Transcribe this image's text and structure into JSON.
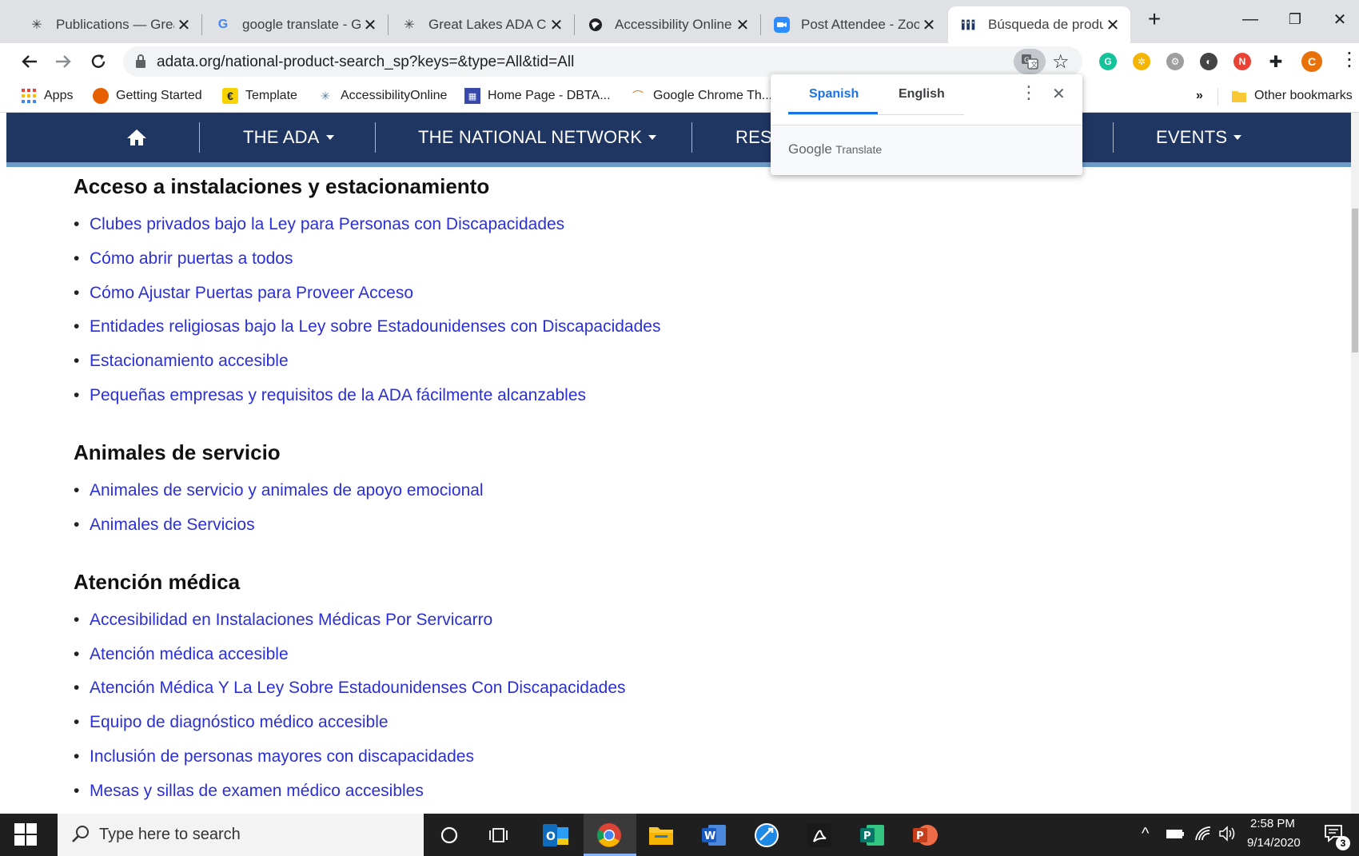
{
  "tabs": [
    {
      "title": "Publications — Great",
      "icon": "great-lakes-icon"
    },
    {
      "title": "google translate - Go",
      "icon": "google-icon"
    },
    {
      "title": "Great Lakes ADA Cen",
      "icon": "great-lakes-icon"
    },
    {
      "title": "Accessibility Online S",
      "icon": "globe-icon"
    },
    {
      "title": "Post Attendee - Zoo",
      "icon": "zoom-icon"
    },
    {
      "title": "Búsqueda de produc",
      "icon": "adata-icon"
    }
  ],
  "toolbar": {
    "url": "adata.org/national-product-search_sp?keys=&type=All&tid=All",
    "profile_initial": "C"
  },
  "bookmarks": {
    "items": [
      "Apps",
      "Getting Started",
      "Template",
      "AccessibilityOnline",
      "Home Page - DBTA...",
      "Google Chrome Th..."
    ],
    "overflow": "»",
    "other": "Other bookmarks"
  },
  "sitenav": {
    "items": [
      "THE ADA",
      "THE NATIONAL NETWORK",
      "RES",
      "EVENTS"
    ]
  },
  "translate": {
    "lang_source": "Spanish",
    "lang_target": "English",
    "brand": "Google",
    "brand_suffix": "Translate"
  },
  "content": {
    "sections": [
      {
        "heading": "Acceso a instalaciones y estacionamiento",
        "links": [
          "Clubes privados bajo la Ley para Personas con Discapacidades",
          "Cómo abrir puertas a todos",
          "Cómo Ajustar Puertas para Proveer Acceso",
          "Entidades religiosas bajo la Ley sobre Estadounidenses con Discapacidades",
          "Estacionamiento accesible",
          "Pequeñas empresas y requisitos de la ADA fácilmente alcanzables"
        ]
      },
      {
        "heading": "Animales de servicio",
        "links": [
          "Animales de servicio y animales de apoyo emocional",
          "Animales de Servicios"
        ]
      },
      {
        "heading": "Atención médica",
        "links": [
          "Accesibilidad en Instalaciones Médicas Por Servicarro",
          "Atención médica accesible",
          "Atención Médica Y La Ley Sobre Estadounidenses Con Discapacidades",
          "Equipo de diagnóstico médico accesible",
          "Inclusión de personas mayores con discapacidades",
          "Mesas y sillas de examen médico accesibles"
        ]
      }
    ]
  },
  "taskbar": {
    "search_placeholder": "Type here to search",
    "time": "2:58 PM",
    "date": "9/14/2020",
    "notifications": "3"
  }
}
